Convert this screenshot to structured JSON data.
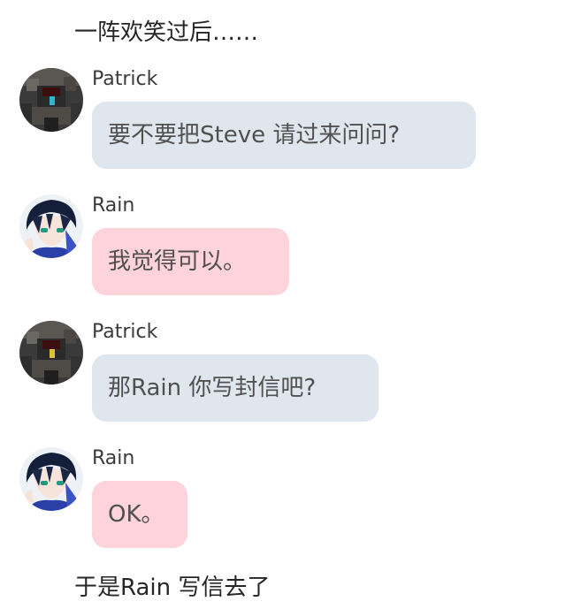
{
  "narration_top": "一阵欢笑过后……",
  "messages": [
    {
      "sender": "Patrick",
      "text": "要不要把Steve 请过来问问?",
      "bubble_color": "#dfe6ee"
    },
    {
      "sender": "Rain",
      "text": "我觉得可以。",
      "bubble_color": "#ffd3dc"
    },
    {
      "sender": "Patrick",
      "text": "那Rain 你写封信吧?",
      "bubble_color": "#dfe6ee"
    },
    {
      "sender": "Rain",
      "text": "OK。",
      "bubble_color": "#ffd3dc"
    }
  ],
  "narration_bottom": "于是Rain 写信去了",
  "avatars": {
    "patrick": "minecraft-skin-avatar",
    "rain": "anime-boy-avatar"
  }
}
